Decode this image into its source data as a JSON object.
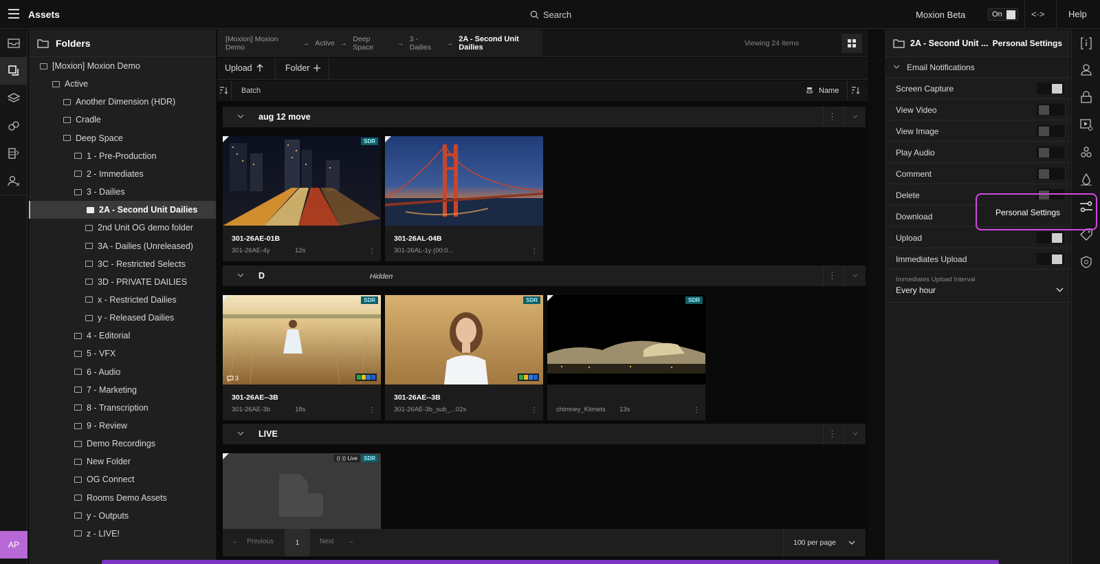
{
  "topbar": {
    "title": "Assets",
    "search": "Search",
    "beta_label": "Moxion Beta",
    "beta_toggle": "On",
    "help": "Help",
    "code_icon": "<·>"
  },
  "avatar": "AP",
  "folders": {
    "title": "Folders",
    "items": [
      {
        "label": "[Moxion] Moxion Demo",
        "level": 0
      },
      {
        "label": "Active",
        "level": 1
      },
      {
        "label": "Another Dimension (HDR)",
        "level": 2
      },
      {
        "label": "Cradle",
        "level": 2
      },
      {
        "label": "Deep Space",
        "level": 2
      },
      {
        "label": "1 - Pre-Production",
        "level": 3
      },
      {
        "label": "2 - Immediates",
        "level": 3
      },
      {
        "label": "3 - Dailies",
        "level": 3
      },
      {
        "label": "2A - Second Unit Dailies",
        "level": 4,
        "selected": true
      },
      {
        "label": "2nd Unit OG demo folder",
        "level": 4
      },
      {
        "label": "3A - Dailies (Unreleased)",
        "level": 4
      },
      {
        "label": "3C - Restricted Selects",
        "level": 4
      },
      {
        "label": "3D - PRIVATE DAILIES",
        "level": 4
      },
      {
        "label": "x - Restricted Dailies",
        "level": 4
      },
      {
        "label": "y - Released Dailies",
        "level": 4
      },
      {
        "label": "4 - Editorial",
        "level": 3
      },
      {
        "label": "5 - VFX",
        "level": 3
      },
      {
        "label": "6 - Audio",
        "level": 3
      },
      {
        "label": "7 - Marketing",
        "level": 3
      },
      {
        "label": "8 - Transcription",
        "level": 3
      },
      {
        "label": "9 - Review",
        "level": 3
      },
      {
        "label": "Demo Recordings",
        "level": 3
      },
      {
        "label": "New Folder",
        "level": 3
      },
      {
        "label": "OG Connect",
        "level": 3
      },
      {
        "label": "Rooms Demo Assets",
        "level": 3
      },
      {
        "label": "y - Outputs",
        "level": 3
      },
      {
        "label": "z - LIVE!",
        "level": 3
      }
    ]
  },
  "breadcrumb": [
    "[Moxion] Moxion Demo",
    "Active",
    "Deep Space",
    "3 - Dailies",
    "2A - Second Unit Dailies"
  ],
  "viewing": "Viewing 24 items",
  "toolbar": {
    "upload": "Upload",
    "folder": "Folder"
  },
  "sortbar": {
    "batch": "Batch",
    "sort_label": "Name"
  },
  "groups": [
    {
      "name": "aug 12 move",
      "hidden": ""
    },
    {
      "name": "D",
      "hidden": "Hidden"
    },
    {
      "name": "LIVE",
      "hidden": ""
    }
  ],
  "cards": [
    {
      "name": "301-26AE-01B",
      "sub": "301-26AE-4y",
      "dur": "12s",
      "badge": "SDR"
    },
    {
      "name": "301-26AL-04B",
      "sub": "301-26AL-1y (00:0...",
      "dur": "",
      "badge": ""
    },
    {
      "name": "301-26AE--3B",
      "sub": "301-26AE-3b",
      "dur": "18s",
      "badge": "SDR",
      "comments": "3"
    },
    {
      "name": "301-26AE--3B",
      "sub": "301-26AE-3b_sub_...02s",
      "dur": "",
      "badge": "SDR"
    },
    {
      "name": "",
      "sub": "chimney_Klimets",
      "dur": "13s",
      "badge": "SDR"
    },
    {
      "name": "",
      "sub": "",
      "dur": "",
      "badge": "SDR",
      "live": "Live"
    }
  ],
  "pager": {
    "prev": "Previous",
    "page": "1",
    "next": "Next",
    "per_page": "100 per page"
  },
  "right_panel": {
    "folder_title": "2A - Second Unit ...",
    "tab": "Personal Settings",
    "section": "Email Notifications",
    "settings": [
      {
        "label": "Screen Capture",
        "on": true
      },
      {
        "label": "View Video",
        "on": false
      },
      {
        "label": "View Image",
        "on": false
      },
      {
        "label": "Play Audio",
        "on": false
      },
      {
        "label": "Comment",
        "on": false
      },
      {
        "label": "Delete",
        "on": false
      },
      {
        "label": "Download",
        "on": false
      },
      {
        "label": "Upload",
        "on": true
      },
      {
        "label": "Immediates Upload",
        "on": true
      }
    ],
    "interval_label": "Immediates Upload Interval",
    "interval_value": "Every hour"
  },
  "tooltip": "Personal Settings",
  "colors": {
    "accent_highlight": "#d24be0",
    "sdr_badge": "#0f5f66",
    "avatar": "#b968d8"
  }
}
